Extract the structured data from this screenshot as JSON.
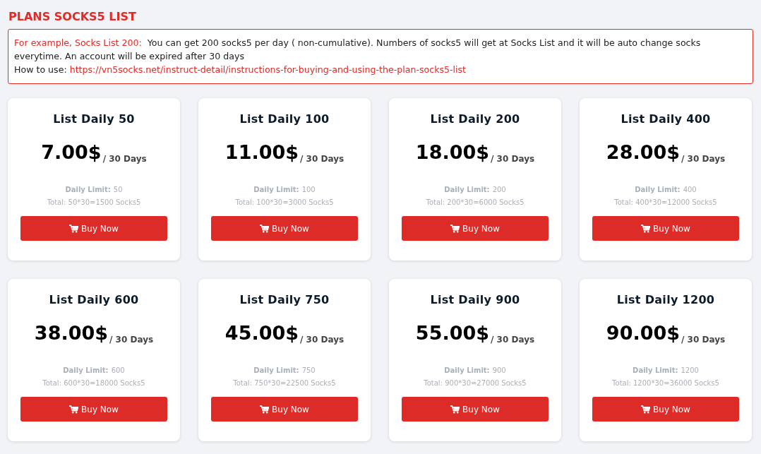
{
  "title": "PLANS SOCKS5 LIST",
  "notice": {
    "lead": "For example, Socks List 200:",
    "text": "You can get 200 socks5 per day ( non-cumulative). Numbers of socks5 will get at Socks List and it will be auto change socks everytime. An account will be expired after 30 days",
    "how_label": "How to use:",
    "link": "https://vn5socks.net/instruct-detail/instructions-for-buying-and-using-the-plan-socks5-list"
  },
  "plans": [
    {
      "name": "List Daily 50",
      "price": "7.00$",
      "period": "/ 30 Days",
      "limit_label": "Daily Limit:",
      "limit": "50",
      "total": "Total: 50*30=1500 Socks5",
      "button": "Buy Now"
    },
    {
      "name": "List Daily 100",
      "price": "11.00$",
      "period": "/ 30 Days",
      "limit_label": "Daily Limit:",
      "limit": "100",
      "total": "Total: 100*30=3000 Socks5",
      "button": "Buy Now"
    },
    {
      "name": "List Daily 200",
      "price": "18.00$",
      "period": "/ 30 Days",
      "limit_label": "Daily Limit:",
      "limit": "200",
      "total": "Total: 200*30=6000 Socks5",
      "button": "Buy Now"
    },
    {
      "name": "List Daily 400",
      "price": "28.00$",
      "period": "/ 30 Days",
      "limit_label": "Daily Limit:",
      "limit": "400",
      "total": "Total: 400*30=12000 Socks5",
      "button": "Buy Now"
    },
    {
      "name": "List Daily 600",
      "price": "38.00$",
      "period": "/ 30 Days",
      "limit_label": "Daily Limit:",
      "limit": "600",
      "total": "Total: 600*30=18000 Socks5",
      "button": "Buy Now"
    },
    {
      "name": "List Daily 750",
      "price": "45.00$",
      "period": "/ 30 Days",
      "limit_label": "Daily Limit:",
      "limit": "750",
      "total": "Total: 750*30=22500 Socks5",
      "button": "Buy Now"
    },
    {
      "name": "List Daily 900",
      "price": "55.00$",
      "period": "/ 30 Days",
      "limit_label": "Daily Limit:",
      "limit": "900",
      "total": "Total: 900*30=27000 Socks5",
      "button": "Buy Now"
    },
    {
      "name": "List Daily 1200",
      "price": "90.00$",
      "period": "/ 30 Days",
      "limit_label": "Daily Limit:",
      "limit": "1200",
      "total": "Total: 1200*30=36000 Socks5",
      "button": "Buy Now"
    }
  ]
}
